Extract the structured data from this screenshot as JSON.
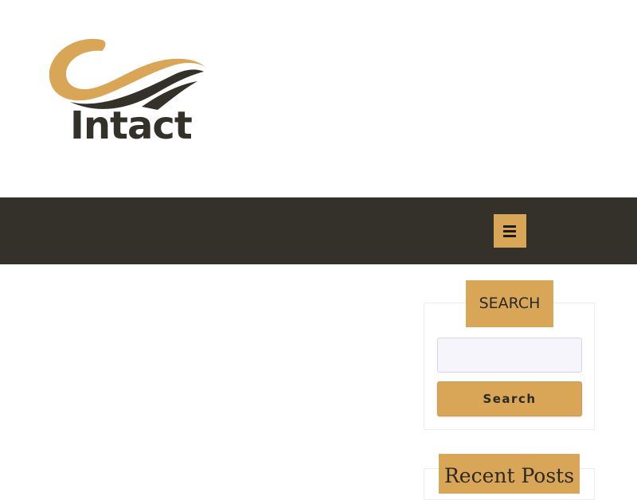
{
  "header": {
    "logo_text": "Intact",
    "logo_colors": {
      "gold": "#d9a657",
      "dark": "#34312b"
    }
  },
  "navbar": {
    "background": "#34312b",
    "menu_icon": "hamburger-menu-icon"
  },
  "sidebar": {
    "search_widget": {
      "title": "SEARCH",
      "input_value": "",
      "button_label": "Search"
    },
    "recent_posts_widget": {
      "title": "Recent Posts"
    }
  },
  "colors": {
    "accent": "#d9a657",
    "nav_bg": "#34312b"
  }
}
